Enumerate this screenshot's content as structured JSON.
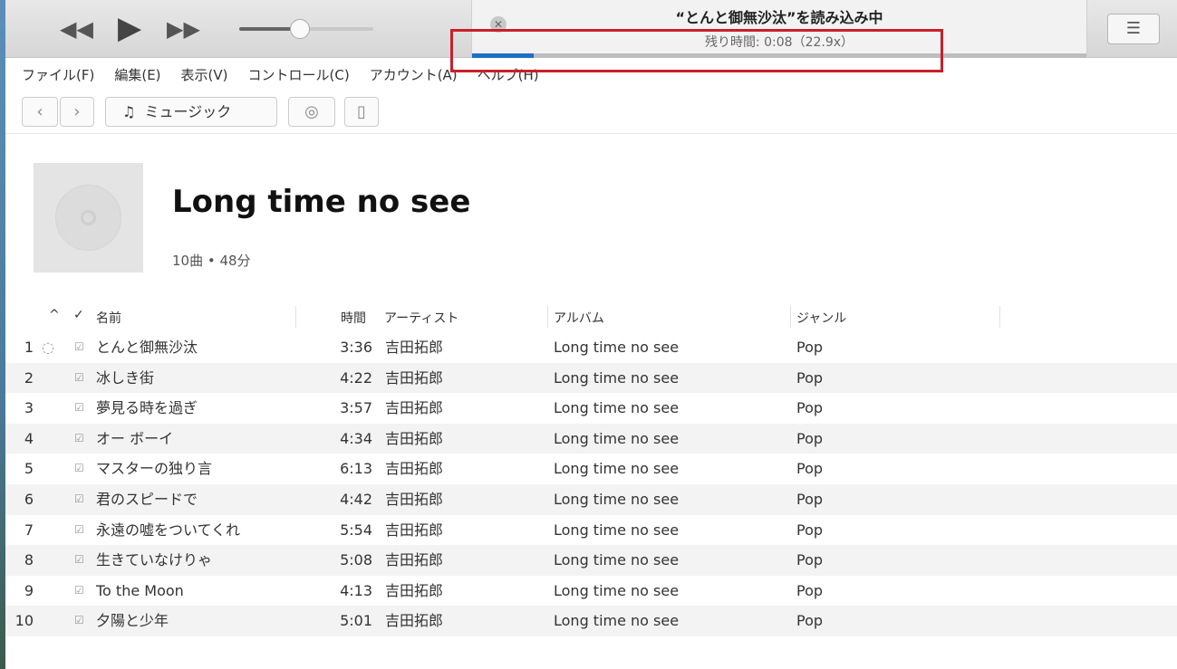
{
  "player": {
    "rewind_icon": "rewind-icon",
    "play_icon": "play-icon",
    "forward_icon": "fast-forward-icon",
    "volume_percent": 43
  },
  "status": {
    "title": "“とんと御無沙汰”を読み込み中",
    "subtitle": "残り時間: 0:08（22.9x）",
    "progress_percent": 10
  },
  "menu": [
    "ファイル(F)",
    "編集(E)",
    "表示(V)",
    "コントロール(C)",
    "アカウント(A)",
    "ヘルプ(H)"
  ],
  "toolbar": {
    "back": "‹",
    "forward": "›",
    "library": "ミュージック"
  },
  "album": {
    "title": "Long time no see",
    "meta": "10曲 • 48分"
  },
  "columns": {
    "sort": "^",
    "check": "✓",
    "name": "名前",
    "time": "時間",
    "artist": "アーティスト",
    "album": "アルバム",
    "genre": "ジャンル"
  },
  "tracks": [
    {
      "no": "1",
      "name": "とんと御無沙汰",
      "time": "3:36",
      "artist": "吉田拓郎",
      "album": "Long time no see",
      "genre": "Pop"
    },
    {
      "no": "2",
      "name": "冰しき街",
      "time": "4:22",
      "artist": "吉田拓郎",
      "album": "Long time no see",
      "genre": "Pop"
    },
    {
      "no": "3",
      "name": "夢見る時を過ぎ",
      "time": "3:57",
      "artist": "吉田拓郎",
      "album": "Long time no see",
      "genre": "Pop"
    },
    {
      "no": "4",
      "name": "オー ボーイ",
      "time": "4:34",
      "artist": "吉田拓郎",
      "album": "Long time no see",
      "genre": "Pop"
    },
    {
      "no": "5",
      "name": "マスターの独り言",
      "time": "6:13",
      "artist": "吉田拓郎",
      "album": "Long time no see",
      "genre": "Pop"
    },
    {
      "no": "6",
      "name": "君のスピードで",
      "time": "4:42",
      "artist": "吉田拓郎",
      "album": "Long time no see",
      "genre": "Pop"
    },
    {
      "no": "7",
      "name": "永遠の嘘をついてくれ",
      "time": "5:54",
      "artist": "吉田拓郎",
      "album": "Long time no see",
      "genre": "Pop"
    },
    {
      "no": "8",
      "name": "生きていなけりゃ",
      "time": "5:08",
      "artist": "吉田拓郎",
      "album": "Long time no see",
      "genre": "Pop"
    },
    {
      "no": "9",
      "name": "To the Moon",
      "time": "4:13",
      "artist": "吉田拓郎",
      "album": "Long time no see",
      "genre": "Pop"
    },
    {
      "no": "10",
      "name": "夕陽と少年",
      "time": "5:01",
      "artist": "吉田拓郎",
      "album": "Long time no see",
      "genre": "Pop"
    }
  ]
}
